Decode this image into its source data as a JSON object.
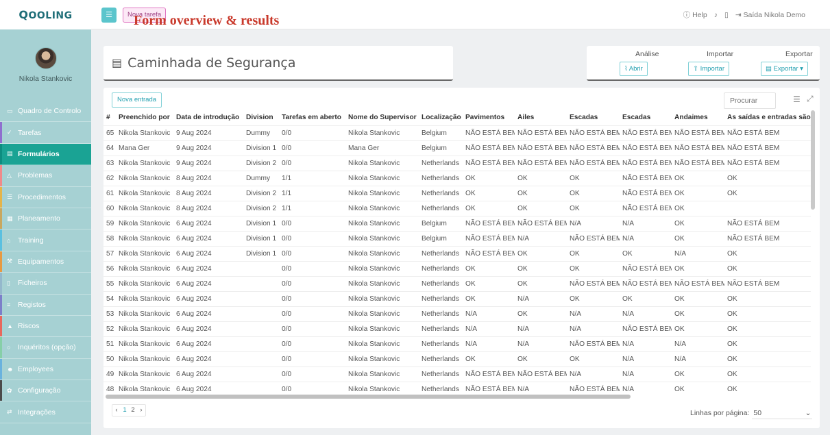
{
  "brand": {
    "logo_first": "Q",
    "logo_rest": "OOLING"
  },
  "sidebar": {
    "user_name": "Nikola Stankovic",
    "items": [
      {
        "label": "Quadro de Controlo",
        "icon": "monitor-icon",
        "glyph": "▭",
        "strip": "#a6d1d3"
      },
      {
        "label": "Tarefas",
        "icon": "check-icon",
        "glyph": "✓",
        "strip": "#8f6fcf"
      },
      {
        "label": "Formulários",
        "icon": "document-icon",
        "glyph": "▤",
        "strip": "#0d8d80"
      },
      {
        "label": "Problemas",
        "icon": "warning-icon",
        "glyph": "△",
        "strip": "#f08a8a"
      },
      {
        "label": "Procedimentos",
        "icon": "list-icon",
        "glyph": "☰",
        "strip": "#e5b449"
      },
      {
        "label": "Planeamento",
        "icon": "calendar-icon",
        "glyph": "▦",
        "strip": "#c9a75f"
      },
      {
        "label": "Training",
        "icon": "graduation-icon",
        "glyph": "⌂",
        "strip": "#5ac0e0"
      },
      {
        "label": "Equipamentos",
        "icon": "wrench-icon",
        "glyph": "⚒",
        "strip": "#e79a42"
      },
      {
        "label": "Ficheiros",
        "icon": "file-icon",
        "glyph": "▯",
        "strip": "#94b8cc"
      },
      {
        "label": "Registos",
        "icon": "bars-icon",
        "glyph": "≡",
        "strip": "#7c7fc9"
      },
      {
        "label": "Riscos",
        "icon": "alert-icon",
        "glyph": "▲",
        "strip": "#e8685d"
      },
      {
        "label": "Inquéritos (opção)",
        "icon": "chat-icon",
        "glyph": "○",
        "strip": "#86cfa8"
      },
      {
        "label": "Employees",
        "icon": "users-icon",
        "glyph": "☻",
        "strip": "#6ab2de"
      },
      {
        "label": "Configuração",
        "icon": "gear-icon",
        "glyph": "✿",
        "strip": "#4a4a4a"
      },
      {
        "label": "Integrações",
        "icon": "exchange-icon",
        "glyph": "⇄",
        "strip": "#a6d1d3"
      }
    ]
  },
  "topbar": {
    "new_task": "Nova tarefa",
    "heading": "Form overview & results",
    "help": "Help",
    "logout": "Saída Nikola Demo"
  },
  "form": {
    "title": "Caminhada de Segurança"
  },
  "actions": {
    "analysis_label": "Análise",
    "open_btn": "Abrir",
    "import_label": "Importar",
    "import_btn": "Importar",
    "export_label": "Exportar",
    "export_btn": "Exportar"
  },
  "toolbar": {
    "new_entry": "Nova entrada",
    "search_placeholder": "Procurar"
  },
  "table": {
    "headers": [
      "#",
      "Preenchido por",
      "Data de introdução",
      "Division",
      "Tarefas em aberto",
      "Nome do Supervisor",
      "Localização",
      "Pavimentos",
      "Ailes",
      "Escadas",
      "Escadas",
      "Andaimes",
      "As saídas e entradas são"
    ],
    "rows": [
      [
        "65",
        "Nikola Stankovic",
        "9 Aug 2024",
        "Dummy",
        "0/0",
        "Nikola Stankovic",
        "Belgium",
        "NÃO ESTÁ BEM",
        "NÃO ESTÁ BEM",
        "NÃO ESTÁ BEM",
        "NÃO ESTÁ BEM",
        "NÃO ESTÁ BEM",
        "NÃO ESTÁ BEM"
      ],
      [
        "64",
        "Mana Ger",
        "9 Aug 2024",
        "Division 1",
        "0/0",
        "Mana Ger",
        "Belgium",
        "NÃO ESTÁ BEM",
        "NÃO ESTÁ BEM",
        "NÃO ESTÁ BEM",
        "NÃO ESTÁ BEM",
        "NÃO ESTÁ BEM",
        "NÃO ESTÁ BEM"
      ],
      [
        "63",
        "Nikola Stankovic",
        "9 Aug 2024",
        "Division 2",
        "0/0",
        "Nikola Stankovic",
        "Netherlands",
        "NÃO ESTÁ BEM",
        "NÃO ESTÁ BEM",
        "NÃO ESTÁ BEM",
        "NÃO ESTÁ BEM",
        "NÃO ESTÁ BEM",
        "NÃO ESTÁ BEM"
      ],
      [
        "62",
        "Nikola Stankovic",
        "8 Aug 2024",
        "Dummy",
        "1/1",
        "Nikola Stankovic",
        "Netherlands",
        "OK",
        "OK",
        "OK",
        "NÃO ESTÁ BEM",
        "OK",
        "OK"
      ],
      [
        "61",
        "Nikola Stankovic",
        "8 Aug 2024",
        "Division 2",
        "1/1",
        "Nikola Stankovic",
        "Netherlands",
        "OK",
        "OK",
        "OK",
        "NÃO ESTÁ BEM",
        "OK",
        "OK"
      ],
      [
        "60",
        "Nikola Stankovic",
        "8 Aug 2024",
        "Division 2",
        "1/1",
        "Nikola Stankovic",
        "Netherlands",
        "OK",
        "OK",
        "OK",
        "NÃO ESTÁ BEM",
        "OK",
        ""
      ],
      [
        "59",
        "Nikola Stankovic",
        "6 Aug 2024",
        "Division 1",
        "0/0",
        "Nikola Stankovic",
        "Belgium",
        "NÃO ESTÁ BEM",
        "NÃO ESTÁ BEM",
        "N/A",
        "N/A",
        "OK",
        "NÃO ESTÁ BEM"
      ],
      [
        "58",
        "Nikola Stankovic",
        "6 Aug 2024",
        "Division 1",
        "0/0",
        "Nikola Stankovic",
        "Belgium",
        "NÃO ESTÁ BEM",
        "N/A",
        "NÃO ESTÁ BEM",
        "N/A",
        "OK",
        "NÃO ESTÁ BEM"
      ],
      [
        "57",
        "Nikola Stankovic",
        "6 Aug 2024",
        "Division 1",
        "0/0",
        "Nikola Stankovic",
        "Netherlands",
        "NÃO ESTÁ BEM",
        "OK",
        "OK",
        "OK",
        "N/A",
        "OK"
      ],
      [
        "56",
        "Nikola Stankovic",
        "6 Aug 2024",
        "",
        "0/0",
        "Nikola Stankovic",
        "Netherlands",
        "OK",
        "OK",
        "OK",
        "NÃO ESTÁ BEM",
        "OK",
        "OK"
      ],
      [
        "55",
        "Nikola Stankovic",
        "6 Aug 2024",
        "",
        "0/0",
        "Nikola Stankovic",
        "Netherlands",
        "OK",
        "OK",
        "NÃO ESTÁ BEM",
        "NÃO ESTÁ BEM",
        "NÃO ESTÁ BEM",
        "NÃO ESTÁ BEM"
      ],
      [
        "54",
        "Nikola Stankovic",
        "6 Aug 2024",
        "",
        "0/0",
        "Nikola Stankovic",
        "Netherlands",
        "OK",
        "N/A",
        "OK",
        "OK",
        "OK",
        "OK"
      ],
      [
        "53",
        "Nikola Stankovic",
        "6 Aug 2024",
        "",
        "0/0",
        "Nikola Stankovic",
        "Netherlands",
        "N/A",
        "OK",
        "N/A",
        "N/A",
        "OK",
        "OK"
      ],
      [
        "52",
        "Nikola Stankovic",
        "6 Aug 2024",
        "",
        "0/0",
        "Nikola Stankovic",
        "Netherlands",
        "N/A",
        "N/A",
        "N/A",
        "NÃO ESTÁ BEM",
        "OK",
        "OK"
      ],
      [
        "51",
        "Nikola Stankovic",
        "6 Aug 2024",
        "",
        "0/0",
        "Nikola Stankovic",
        "Netherlands",
        "N/A",
        "N/A",
        "NÃO ESTÁ BEM",
        "N/A",
        "N/A",
        "OK"
      ],
      [
        "50",
        "Nikola Stankovic",
        "6 Aug 2024",
        "",
        "0/0",
        "Nikola Stankovic",
        "Netherlands",
        "OK",
        "OK",
        "OK",
        "N/A",
        "N/A",
        "OK"
      ],
      [
        "49",
        "Nikola Stankovic",
        "6 Aug 2024",
        "",
        "0/0",
        "Nikola Stankovic",
        "Netherlands",
        "NÃO ESTÁ BEM",
        "NÃO ESTÁ BEM",
        "N/A",
        "N/A",
        "OK",
        "OK"
      ],
      [
        "48",
        "Nikola Stankovic",
        "6 Aug 2024",
        "",
        "0/0",
        "Nikola Stankovic",
        "Netherlands",
        "NÃO ESTÁ BEM",
        "N/A",
        "NÃO ESTÁ BEM",
        "N/A",
        "OK",
        "OK"
      ]
    ]
  },
  "pagination": {
    "prev": "‹",
    "pages": [
      "1",
      "2"
    ],
    "next": "›",
    "current": "1"
  },
  "rows_per_page": {
    "label": "Linhas por página:",
    "value": "50"
  }
}
